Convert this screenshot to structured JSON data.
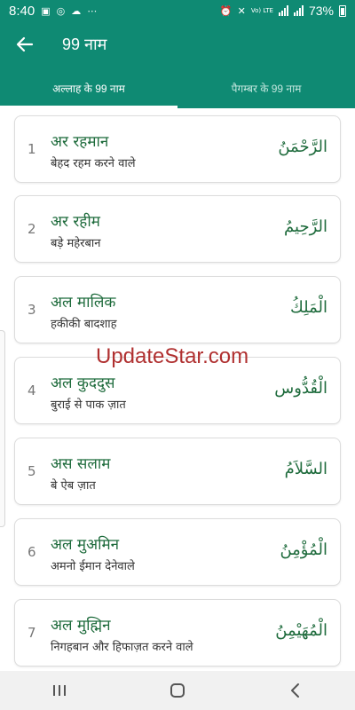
{
  "status_bar": {
    "time": "8:40",
    "battery_percent": "73%",
    "network_label": "Vo) LTE",
    "network_sub": "LTE1"
  },
  "app_bar": {
    "back_icon": "arrow-left-icon",
    "title": "99 नाम"
  },
  "tabs": [
    {
      "label": "अल्लाह के 99 नाम",
      "active": true
    },
    {
      "label": "पैगम्बर के 99 नाम",
      "active": false
    }
  ],
  "names": [
    {
      "number": "1",
      "name": "अर रहमान",
      "meaning": "बेहद रहम करने वाले",
      "arabic": "الرَّحْمَنُ"
    },
    {
      "number": "2",
      "name": "अर रहीम",
      "meaning": "बड़े महेरबान",
      "arabic": "الرَّحِيمُ"
    },
    {
      "number": "3",
      "name": "अल मालिक",
      "meaning": "हकीकी बादशाह",
      "arabic": "الْمَلِكُ"
    },
    {
      "number": "4",
      "name": "अल कुददुस",
      "meaning": "बुराई से पाक ज़ात",
      "arabic": "الْقُدُّوس"
    },
    {
      "number": "5",
      "name": "अस सलाम",
      "meaning": "बे ऐब ज़ात",
      "arabic": "السَّلاَمُ"
    },
    {
      "number": "6",
      "name": "अल मुअमिन",
      "meaning": "अमनो ईमान देनेवाले",
      "arabic": "الْمُؤْمِنُ"
    },
    {
      "number": "7",
      "name": "अल मुह्मिन",
      "meaning": "निगहबान और हिफाज़त करने वाले",
      "arabic": "الْمُهَيْمِنُ"
    }
  ],
  "watermark": "UpdateStar.com",
  "nav_bar": {
    "recents_icon": "recents-icon",
    "home_icon": "home-icon",
    "back_icon": "back-chevron-icon"
  },
  "colors": {
    "primary": "#0f8a73",
    "name_text": "#1e6b3c",
    "watermark": "#b03030"
  }
}
